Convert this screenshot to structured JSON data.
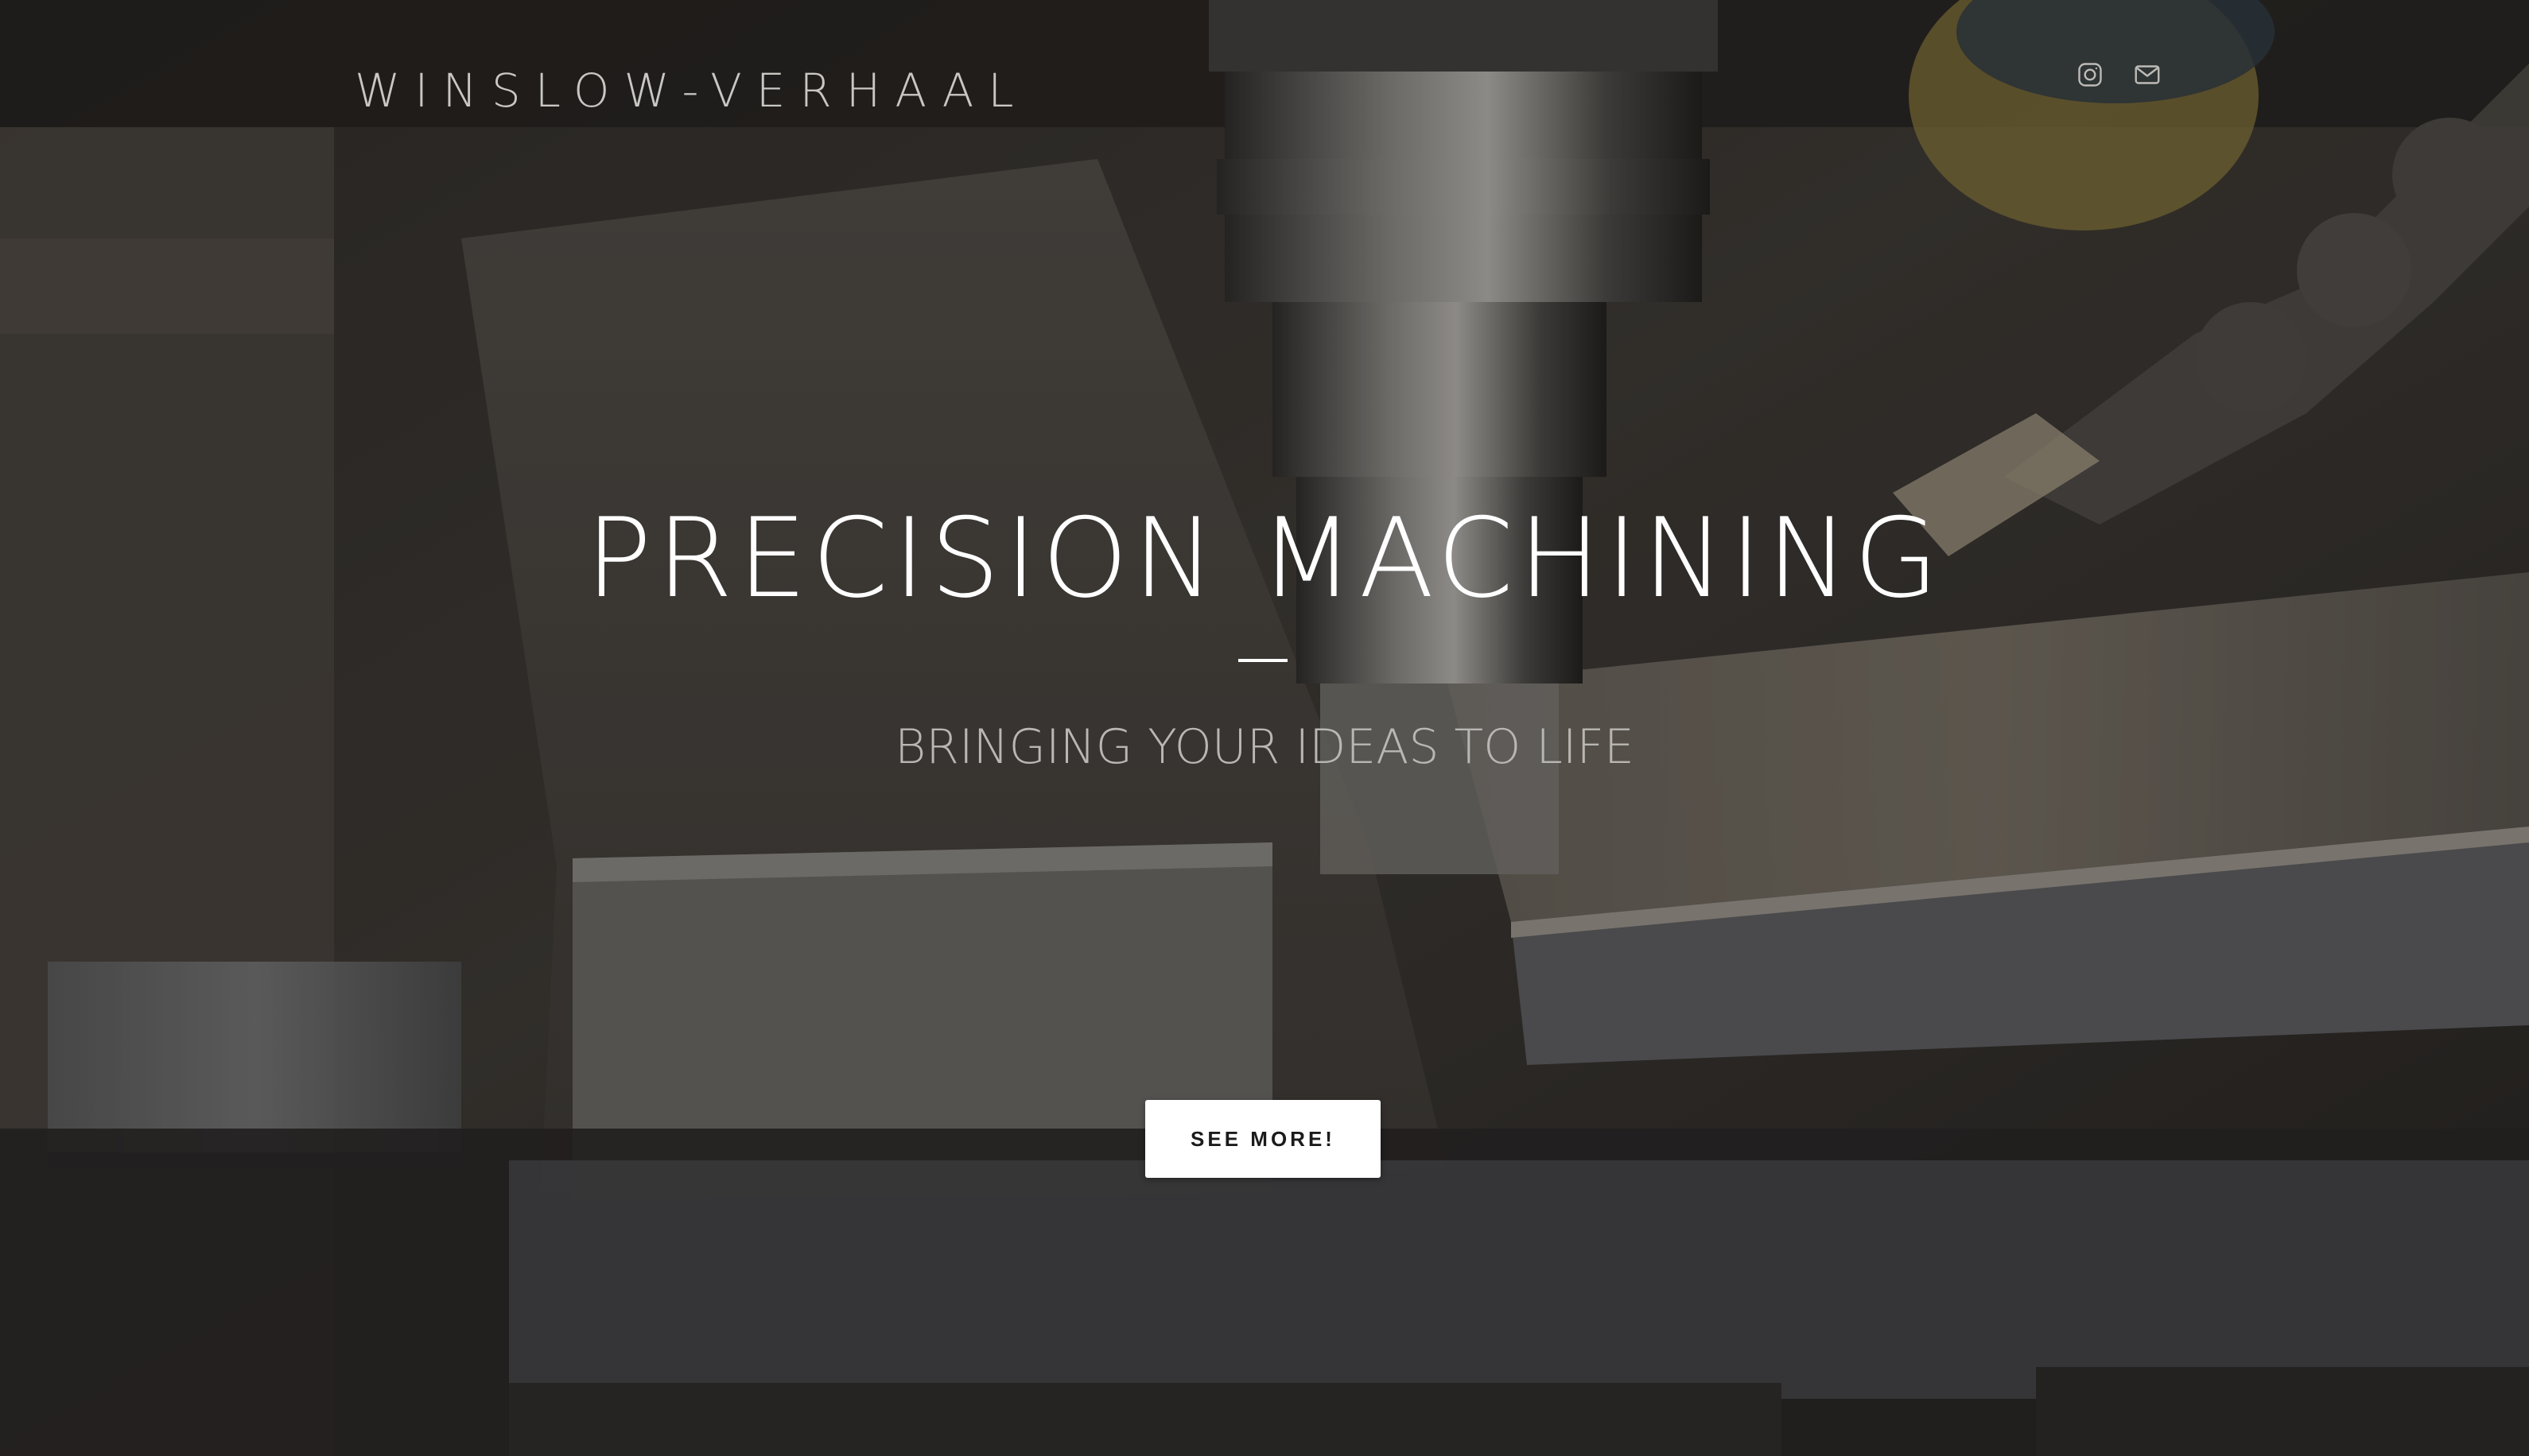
{
  "brand": {
    "logo_text": "WINSLOW-VERHAAL"
  },
  "social": {
    "instagram_icon": "instagram-icon",
    "email_icon": "envelope-icon"
  },
  "hero": {
    "headline": "PRECISION MACHINING",
    "subheadline": "BRINGING YOUR IDEAS TO LIFE",
    "cta_label": "SEE MORE!"
  },
  "colors": {
    "headline": "#ffffff",
    "subheadline": "#b9b7b3",
    "logo": "#c9c7c3",
    "cta_background": "#ffffff",
    "cta_text": "#1b1b1b",
    "icons": "#bdbbb7"
  }
}
